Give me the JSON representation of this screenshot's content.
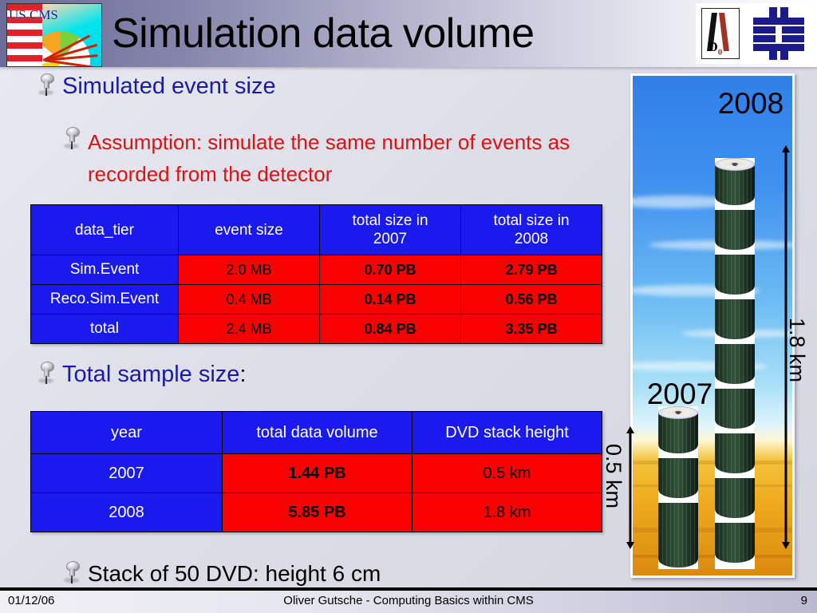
{
  "slide": {
    "title": "Simulation data volume",
    "logo_left_text": "US CMS",
    "logo_d0_text": "D0"
  },
  "bullets": {
    "simulated_event_size": "Simulated event size",
    "assumption": "Assumption: simulate the same number of events as recorded from the detector",
    "total_sample_size": "Total sample size",
    "total_sample_size_colon": ":",
    "stack_of_50": "Stack of 50 DVD: height 6 cm"
  },
  "table_event_size": {
    "headers": [
      "data_tier",
      "event size",
      "total size in 2007",
      "total size in 2008"
    ],
    "header_lines": [
      [
        "data_tier"
      ],
      [
        "event size"
      ],
      [
        "total size in",
        "2007"
      ],
      [
        "total size in",
        "2008"
      ]
    ],
    "rows": [
      {
        "tier": "Sim.Event",
        "event_size": "2.0 MB",
        "size_2007": "0.70 PB",
        "size_2008": "2.79 PB"
      },
      {
        "tier": "Reco.Sim.Event",
        "event_size": "0.4 MB",
        "size_2007": "0.14 PB",
        "size_2008": "0.56 PB"
      },
      {
        "tier": "total",
        "event_size": "2.4 MB",
        "size_2007": "0.84 PB",
        "size_2008": "3.35 PB"
      }
    ]
  },
  "table_total_volume": {
    "headers": [
      "year",
      "total data volume",
      "DVD stack height"
    ],
    "rows": [
      {
        "year": "2007",
        "volume": "1.44 PB",
        "height": "0.5 km"
      },
      {
        "year": "2008",
        "volume": "5.85 PB",
        "height": "1.8 km"
      }
    ]
  },
  "photo": {
    "label_2008": "2008",
    "label_2007": "2007",
    "measure_2008": "1.8 km",
    "measure_2007": "0.5 km"
  },
  "footer": {
    "date": "01/12/06",
    "center": "Oliver Gutsche - Computing Basics within CMS",
    "page": "9"
  },
  "colors": {
    "table_blue": "#1a1aee",
    "table_red": "#fb0000",
    "bullet_blue": "#1a1aa8",
    "bullet_red": "#e01010"
  },
  "chart_data": {
    "type": "bar",
    "title": "DVD stack height by year",
    "categories": [
      "2007",
      "2008"
    ],
    "values": [
      0.5,
      1.8
    ],
    "xlabel": "year",
    "ylabel": "DVD stack height (km)",
    "ylim": [
      0,
      1.8
    ],
    "data_volume_pb": [
      1.44,
      5.85
    ],
    "annotations": [
      "0.5 km",
      "1.8 km"
    ]
  }
}
